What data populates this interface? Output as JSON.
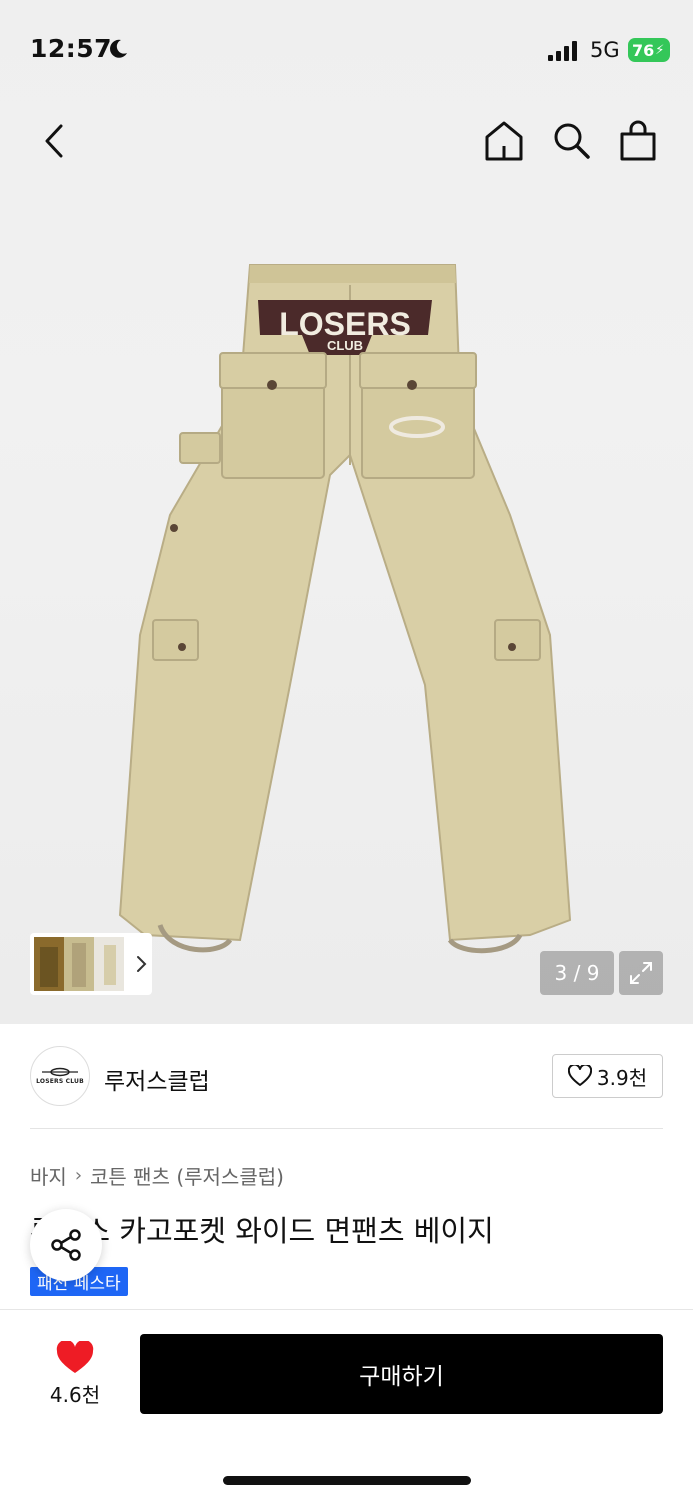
{
  "status_bar": {
    "time": "12:57",
    "network": "5G",
    "battery": "76"
  },
  "icons": {
    "back": "chevron-left-icon",
    "home": "home-icon",
    "search": "search-icon",
    "bag": "shopping-bag-icon",
    "expand": "expand-icon",
    "share": "share-icon",
    "heart": "heart-icon"
  },
  "gallery": {
    "page_indicator": "3 / 9",
    "current_page": 3,
    "total_pages": 9
  },
  "product_image_print": {
    "brand_top": "LOSERS",
    "brand_bottom": "CLUB"
  },
  "brand": {
    "logo_text": "LOSERS CLUB",
    "name": "루저스클럽",
    "like_count": "3.9천"
  },
  "breadcrumb": {
    "category": "바지",
    "subcategory": "코튼 팬츠 (루저스클럽)"
  },
  "product": {
    "title": "루저스 카고포켓 와이드 면팬츠 베이지",
    "badge": "패션 페스타"
  },
  "bottom_bar": {
    "wish_count": "4.6천",
    "buy_label": "구매하기"
  },
  "colors": {
    "battery_green": "#34c759",
    "badge_blue": "#1e66f5",
    "heart_red": "#ee1c25",
    "buy_button": "#000000"
  }
}
